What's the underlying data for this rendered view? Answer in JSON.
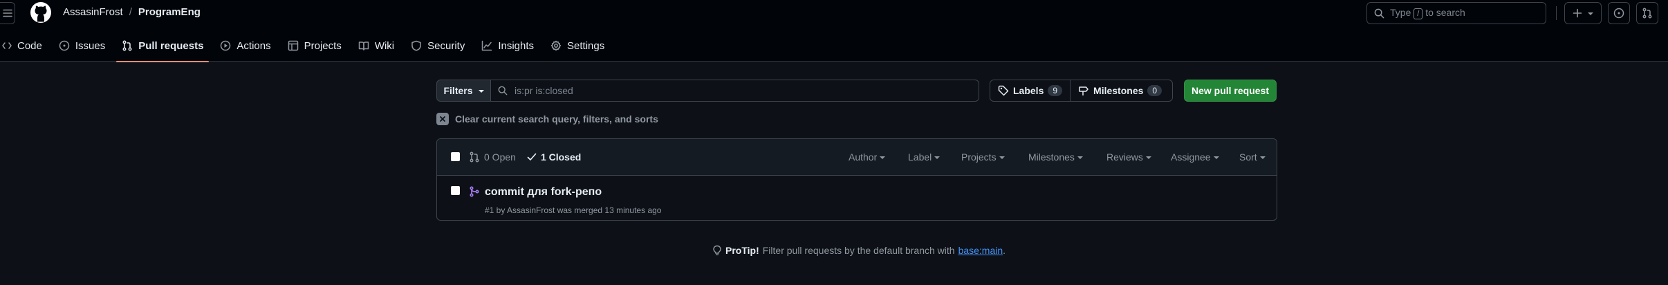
{
  "breadcrumb": {
    "owner": "AssasinFrost",
    "separator": "/",
    "repo": "ProgramEng"
  },
  "search": {
    "before": "Type",
    "key": "/",
    "after": "to search"
  },
  "tabs": [
    {
      "label": "Code",
      "icon": "code-icon"
    },
    {
      "label": "Issues",
      "icon": "issue-icon"
    },
    {
      "label": "Pull requests",
      "icon": "git-pull-request-icon",
      "active": true
    },
    {
      "label": "Actions",
      "icon": "play-icon"
    },
    {
      "label": "Projects",
      "icon": "table-icon"
    },
    {
      "label": "Wiki",
      "icon": "book-icon"
    },
    {
      "label": "Security",
      "icon": "shield-icon"
    },
    {
      "label": "Insights",
      "icon": "graph-icon"
    },
    {
      "label": "Settings",
      "icon": "gear-icon"
    }
  ],
  "toolbar": {
    "filters_label": "Filters",
    "query": "is:pr is:closed",
    "labels_label": "Labels",
    "labels_count": "9",
    "milestones_label": "Milestones",
    "milestones_count": "0",
    "new_pr_label": "New pull request"
  },
  "clear_label": "Clear current search query, filters, and sorts",
  "list": {
    "open_label": "0 Open",
    "closed_label": "1 Closed",
    "filters": [
      "Author",
      "Label",
      "Projects",
      "Milestones",
      "Reviews",
      "Assignee",
      "Sort"
    ],
    "items": [
      {
        "title": "commit для fork-репо",
        "meta": "#1 by AssasinFrost was merged 13 minutes ago",
        "state": "merged"
      }
    ]
  },
  "protip": {
    "strong": "ProTip!",
    "text": "Filter pull requests by the default branch with",
    "link": "base:main",
    "end": "."
  },
  "colors": {
    "accent": "#fd8c73",
    "primary_button": "#238636",
    "merged": "#ab7df8",
    "link": "#4493f8"
  }
}
